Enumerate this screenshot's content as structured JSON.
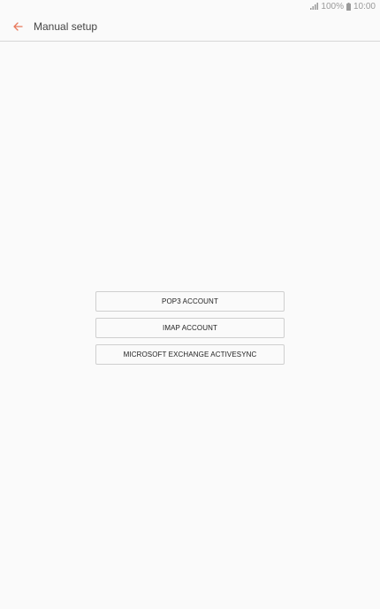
{
  "status_bar": {
    "battery": "100%",
    "time": "10:00",
    "signal_icon": "signal-bars-icon",
    "battery_icon": "battery-icon"
  },
  "app_bar": {
    "title": "Manual setup",
    "back_icon": "back-arrow-icon"
  },
  "account_types": [
    {
      "label": "POP3 ACCOUNT"
    },
    {
      "label": "IMAP ACCOUNT"
    },
    {
      "label": "MICROSOFT EXCHANGE ACTIVESYNC"
    }
  ],
  "colors": {
    "accent": "#e8785a",
    "background": "#fafafa",
    "border": "#cfcfcf"
  }
}
